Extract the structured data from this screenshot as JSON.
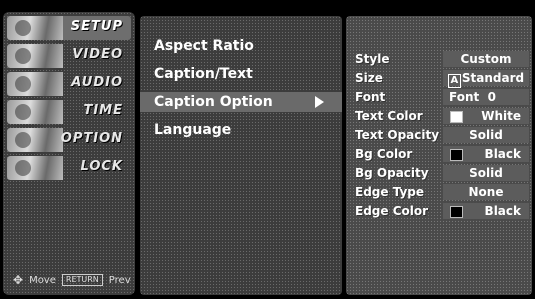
{
  "sidebar": {
    "categories": [
      {
        "label": "SETUP",
        "icon": "setup-icon",
        "active": true
      },
      {
        "label": "VIDEO",
        "icon": "video-icon",
        "active": false
      },
      {
        "label": "AUDIO",
        "icon": "audio-icon",
        "active": false
      },
      {
        "label": "TIME",
        "icon": "time-icon",
        "active": false
      },
      {
        "label": "OPTION",
        "icon": "option-icon",
        "active": false
      },
      {
        "label": "LOCK",
        "icon": "lock-icon",
        "active": false
      }
    ],
    "hint": {
      "move": "Move",
      "prev_key": "RETURN",
      "prev": "Prev"
    }
  },
  "menu": {
    "items": [
      {
        "label": "Aspect Ratio"
      },
      {
        "label": "Caption/Text"
      },
      {
        "label": "Caption Option",
        "selected": true
      },
      {
        "label": "Language"
      }
    ]
  },
  "options": {
    "rows": [
      {
        "label": "Style",
        "value": "Custom"
      },
      {
        "label": "Size",
        "value": "Standard",
        "icon": "font-size-icon",
        "icon_text": "A"
      },
      {
        "label": "Font",
        "value": "Font  0"
      },
      {
        "label": "Text Color",
        "value": "White",
        "swatch": "#ffffff"
      },
      {
        "label": "Text Opacity",
        "value": "Solid"
      },
      {
        "label": "Bg Color",
        "value": "Black",
        "swatch": "#000000"
      },
      {
        "label": "Bg Opacity",
        "value": "Solid"
      },
      {
        "label": "Edge Type",
        "value": "None"
      },
      {
        "label": "Edge Color",
        "value": "Black",
        "swatch": "#000000"
      }
    ]
  },
  "colors": {
    "background": "#000000",
    "panel": "#3c3c3c",
    "highlight": "#6a6a6a"
  }
}
